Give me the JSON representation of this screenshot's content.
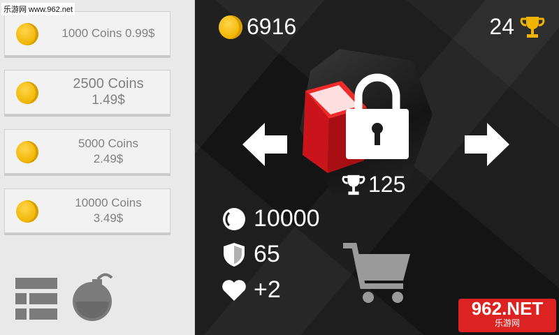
{
  "watermark": {
    "site": "乐游网 www.962.net",
    "brand": "962.NET",
    "brand_sub": "乐游网"
  },
  "shop": {
    "packs": [
      {
        "line1": "1000 Coins 0.99$"
      },
      {
        "line1": "2500 Coins",
        "line2": "1.49$"
      },
      {
        "line1": "5000 Coins",
        "line2": "2.49$"
      },
      {
        "line1": "10000 Coins",
        "line2": "3.49$"
      }
    ]
  },
  "hud": {
    "coins": "6916",
    "trophies": "24"
  },
  "item": {
    "required_trophies": "125",
    "price": "10000",
    "defense": "65",
    "lives": "+2"
  },
  "colors": {
    "coin": "#f0b400",
    "item": "#d71920",
    "sidebar": "#e9e9e9",
    "background": "#1e1e1e"
  }
}
